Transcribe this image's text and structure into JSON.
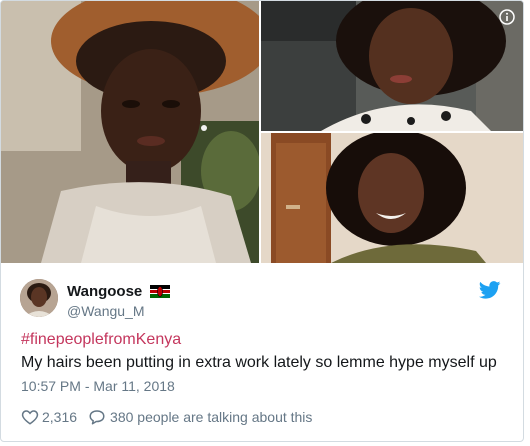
{
  "tweet": {
    "display_name": "Wangoose",
    "handle": "@Wangu_M",
    "hashtag": "#finepeoplefromKenya",
    "text": "My hairs been putting in extra work lately so lemme hype myself up",
    "timestamp": "10:57 PM - Mar 11, 2018",
    "likes": "2,316",
    "talking": "380 people are talking about this"
  },
  "icons": {
    "info": "info-icon",
    "bird": "twitter-bird-icon",
    "flag": "kenya-flag-icon",
    "heart": "heart-icon",
    "comment": "comment-bubble-icon"
  },
  "colors": {
    "hashtag": "#c4365d",
    "twitter_blue": "#1da1f2",
    "muted": "#657786",
    "text": "#14171a"
  }
}
